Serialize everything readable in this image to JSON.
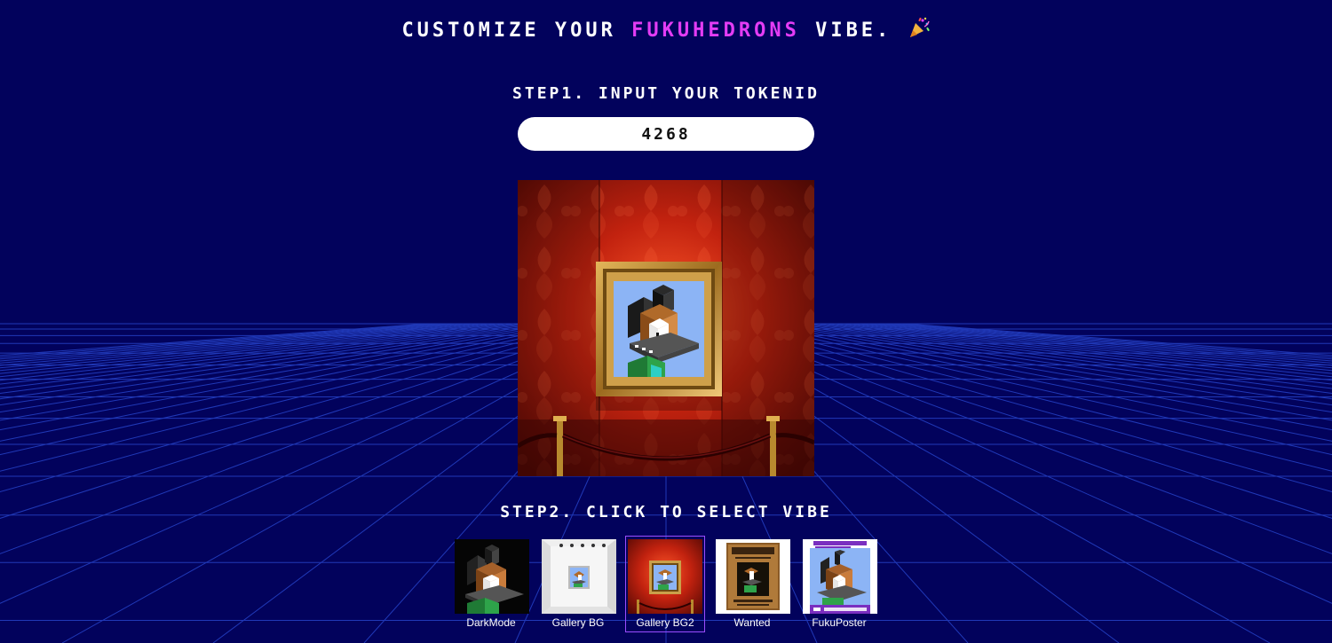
{
  "header": {
    "title_prefix": "CUSTOMIZE YOUR ",
    "title_brand": "FUKUHEDRONS",
    "title_suffix": " VIBE. ",
    "title_icon": "party-popper-icon"
  },
  "step1": {
    "label": "STEP1. INPUT YOUR TOKENID",
    "token_value": "4268"
  },
  "preview": {
    "selected_vibe": "Gallery BG2"
  },
  "step2": {
    "label": "STEP2. CLICK TO SELECT VIBE",
    "vibes": [
      {
        "label": "DarkMode",
        "selected": false
      },
      {
        "label": "Gallery BG",
        "selected": false
      },
      {
        "label": "Gallery BG2",
        "selected": true
      },
      {
        "label": "Wanted",
        "selected": false
      },
      {
        "label": "FukuPoster",
        "selected": false
      }
    ]
  },
  "colors": {
    "background": "#02025c",
    "grid_line": "#2a4bd6",
    "brand_accent": "#e43cf5",
    "selected_border": "#9b4dff"
  }
}
